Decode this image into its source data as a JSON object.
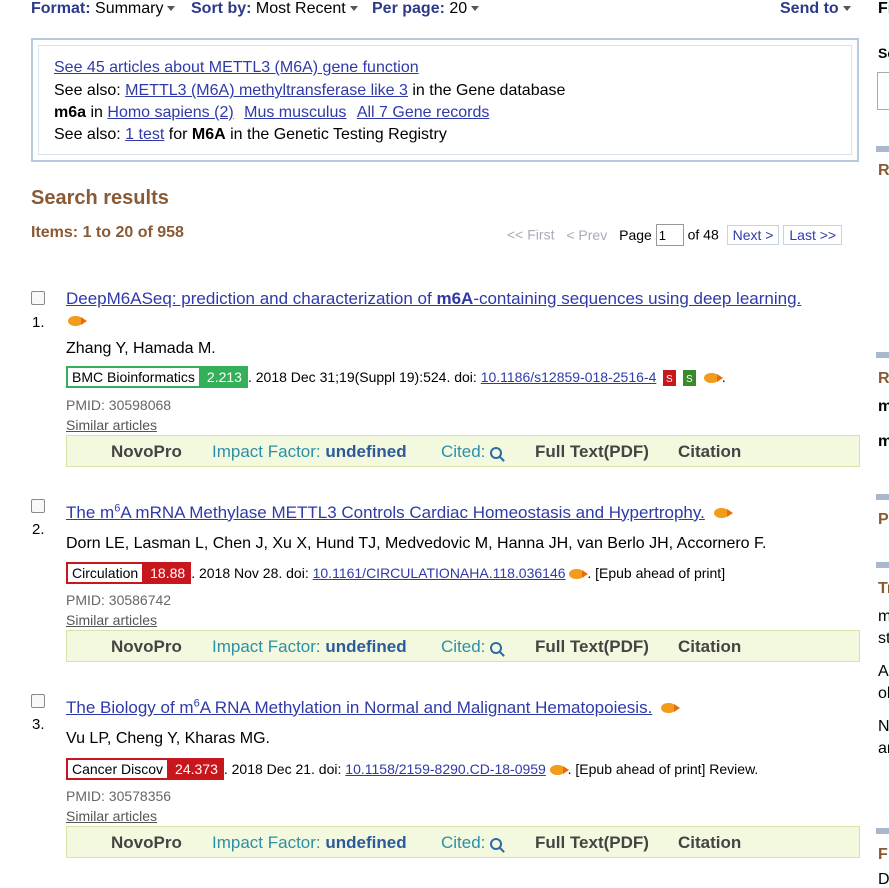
{
  "toolbar": {
    "format_label": "Format:",
    "format_value": "Summary",
    "sort_label": "Sort by:",
    "sort_value": "Most Recent",
    "perpage_label": "Per page:",
    "perpage_value": "20",
    "send_to": "Send to"
  },
  "info": {
    "line1": "See 45 articles about METTL3 (M6A) gene function",
    "line2_prefix": "See also:",
    "line2_link": "METTL3 (M6A) methyltransferase like 3",
    "line2_suffix": "in the Gene database",
    "line3_bold": "m6a",
    "line3_in": "in",
    "line3_link1": "Homo sapiens (2)",
    "line3_link2": "Mus musculus",
    "line3_link3": "All 7 Gene records",
    "line4_prefix": "See also:",
    "line4_link": "1 test",
    "line4_for": "for",
    "line4_bold": "M6A",
    "line4_suffix": "in the Genetic Testing Registry"
  },
  "results_header": {
    "title": "Search results",
    "items": "Items: 1 to 20 of 958"
  },
  "pager": {
    "first": "<< First",
    "prev": "< Prev",
    "page_label": "Page",
    "page_value": "1",
    "of": "of 48",
    "next": "Next >",
    "last": "Last >>"
  },
  "results": [
    {
      "num": "1.",
      "title": "DeepM6ASeq: prediction and characterization of m6A-containing sequences using deep learning.",
      "authors": "Zhang Y, Hamada M.",
      "journal": "BMC Bioinformatics",
      "impact": "2.213",
      "journal_color": "#35b05a",
      "citation": ". 2018 Dec 31;19(Suppl 19):524. doi:",
      "doi": "10.1186/s12859-018-2516-4",
      "suffix": ".",
      "pmid": "PMID: 30598068",
      "similar": "Similar articles"
    },
    {
      "num": "2.",
      "title": "The m6A mRNA Methylase METTL3 Controls Cardiac Homeostasis and Hypertrophy.",
      "authors": "Dorn LE, Lasman L, Chen J, Xu X, Hund TJ, Medvedovic M, Hanna JH, van Berlo JH, Accornero F.",
      "journal": "Circulation",
      "impact": "18.88",
      "journal_color": "#c8161d",
      "citation": ". 2018 Nov 28. doi:",
      "doi": "10.1161/CIRCULATIONAHA.118.036146",
      "suffix": ". [Epub ahead of print]",
      "pmid": "PMID: 30586742",
      "similar": "Similar articles"
    },
    {
      "num": "3.",
      "title": "The Biology of m6A RNA Methylation in Normal and Malignant Hematopoiesis.",
      "authors": "Vu LP, Cheng Y, Kharas MG.",
      "journal": "Cancer Discov",
      "impact": "24.373",
      "journal_color": "#c8161d",
      "citation": ". 2018 Dec 21. doi:",
      "doi": "10.1158/2159-8290.CD-18-0959",
      "suffix": ". [Epub ahead of print] Review.",
      "pmid": "PMID: 30578356",
      "similar": "Similar articles"
    }
  ],
  "novobar": {
    "novopro": "NovoPro",
    "impact_label": "Impact Factor:",
    "impact_value": "undefined",
    "cited": "Cited:",
    "fulltext": "Full Text(PDF)",
    "citation": "Citation"
  },
  "right_column": [
    "Fi",
    "Se",
    "R",
    "R",
    "m",
    "m",
    "P",
    "Tr",
    "m",
    "st",
    "A",
    "ol",
    "N",
    "ar",
    "F",
    "D"
  ]
}
